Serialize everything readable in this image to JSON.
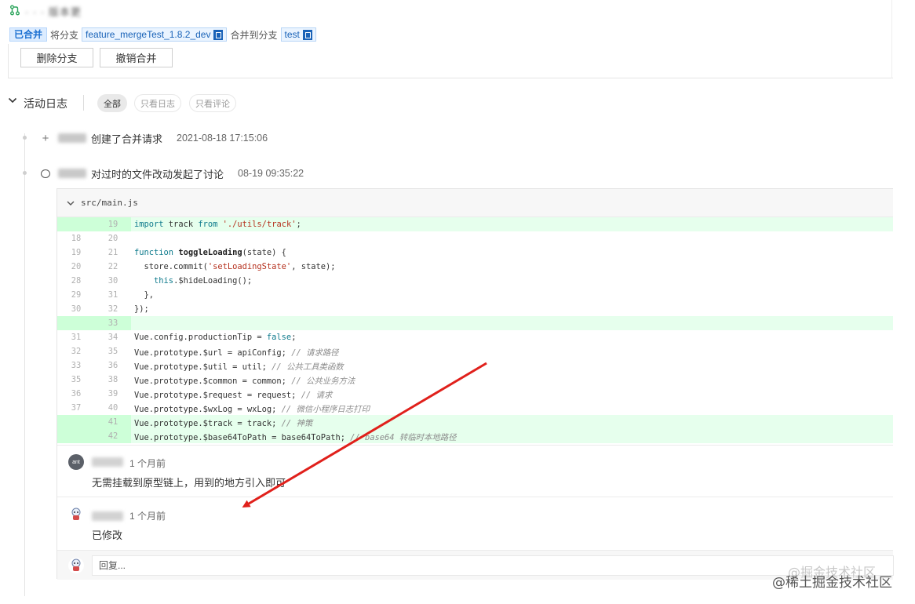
{
  "header": {
    "mr_title": "· · · 版本更",
    "status_badge": "已合并",
    "source_prefix": "将分支",
    "source_branch": "feature_mergeTest_1.8.2_dev",
    "target_prefix": "合并到分支",
    "target_branch": "test",
    "delete_branch_label": "删除分支",
    "revert_merge_label": "撤销合并"
  },
  "activity": {
    "title": "活动日志",
    "filters": [
      "全部",
      "只看日志",
      "只看评论"
    ],
    "active_filter": "全部",
    "events": [
      {
        "icon": "plus-icon",
        "text": "创建了合并请求",
        "time": "2021-08-18 17:15:06"
      },
      {
        "icon": "chat-icon",
        "text": "对过时的文件改动发起了讨论",
        "time": "08-19 09:35:22"
      }
    ]
  },
  "discussion": {
    "file_name": "src/main.js",
    "code_lines": [
      {
        "old": "",
        "new": "19",
        "added": true,
        "text": "import track from './utils/track';"
      },
      {
        "old": "18",
        "new": "20",
        "added": false,
        "text": ""
      },
      {
        "old": "19",
        "new": "21",
        "added": false,
        "text": "function toggleLoading(state) {"
      },
      {
        "old": "20",
        "new": "22",
        "added": false,
        "text": "  store.commit('setLoadingState', state);"
      },
      {
        "old": "28",
        "new": "30",
        "added": false,
        "text": "    this.$hideLoading();"
      },
      {
        "old": "29",
        "new": "31",
        "added": false,
        "text": "  },"
      },
      {
        "old": "30",
        "new": "32",
        "added": false,
        "text": "});"
      },
      {
        "old": "",
        "new": "33",
        "added": true,
        "text": ""
      },
      {
        "old": "31",
        "new": "34",
        "added": false,
        "text": "Vue.config.productionTip = false;"
      },
      {
        "old": "32",
        "new": "35",
        "added": false,
        "text": "Vue.prototype.$url = apiConfig; // 请求路径"
      },
      {
        "old": "33",
        "new": "36",
        "added": false,
        "text": "Vue.prototype.$util = util; // 公共工具类函数"
      },
      {
        "old": "35",
        "new": "38",
        "added": false,
        "text": "Vue.prototype.$common = common; // 公共业务方法"
      },
      {
        "old": "36",
        "new": "39",
        "added": false,
        "text": "Vue.prototype.$request = request; // 请求"
      },
      {
        "old": "37",
        "new": "40",
        "added": false,
        "text": "Vue.prototype.$wxLog = wxLog; // 微信小程序日志打印"
      },
      {
        "old": "",
        "new": "41",
        "added": true,
        "text": "Vue.prototype.$track = track; // 神策"
      },
      {
        "old": "",
        "new": "42",
        "added": true,
        "text": "Vue.prototype.$base64ToPath = base64ToPath; // base64 转临时本地路径"
      }
    ],
    "comments": [
      {
        "avatar_label": "ant",
        "time": "1 个月前",
        "text": "无需挂载到原型链上，用到的地方引入即可"
      },
      {
        "avatar_label": "",
        "time": "1 个月前",
        "text": "已修改"
      }
    ],
    "reply_placeholder": "回复..."
  },
  "watermark": {
    "ghost": "@掘金技术社区",
    "main": "@稀土掘金技术社区"
  },
  "colors": {
    "accent": "#1a6fd1",
    "added_bg": "#e6ffed",
    "added_gutter": "#cdffd8",
    "arrow": "#e0201b"
  }
}
